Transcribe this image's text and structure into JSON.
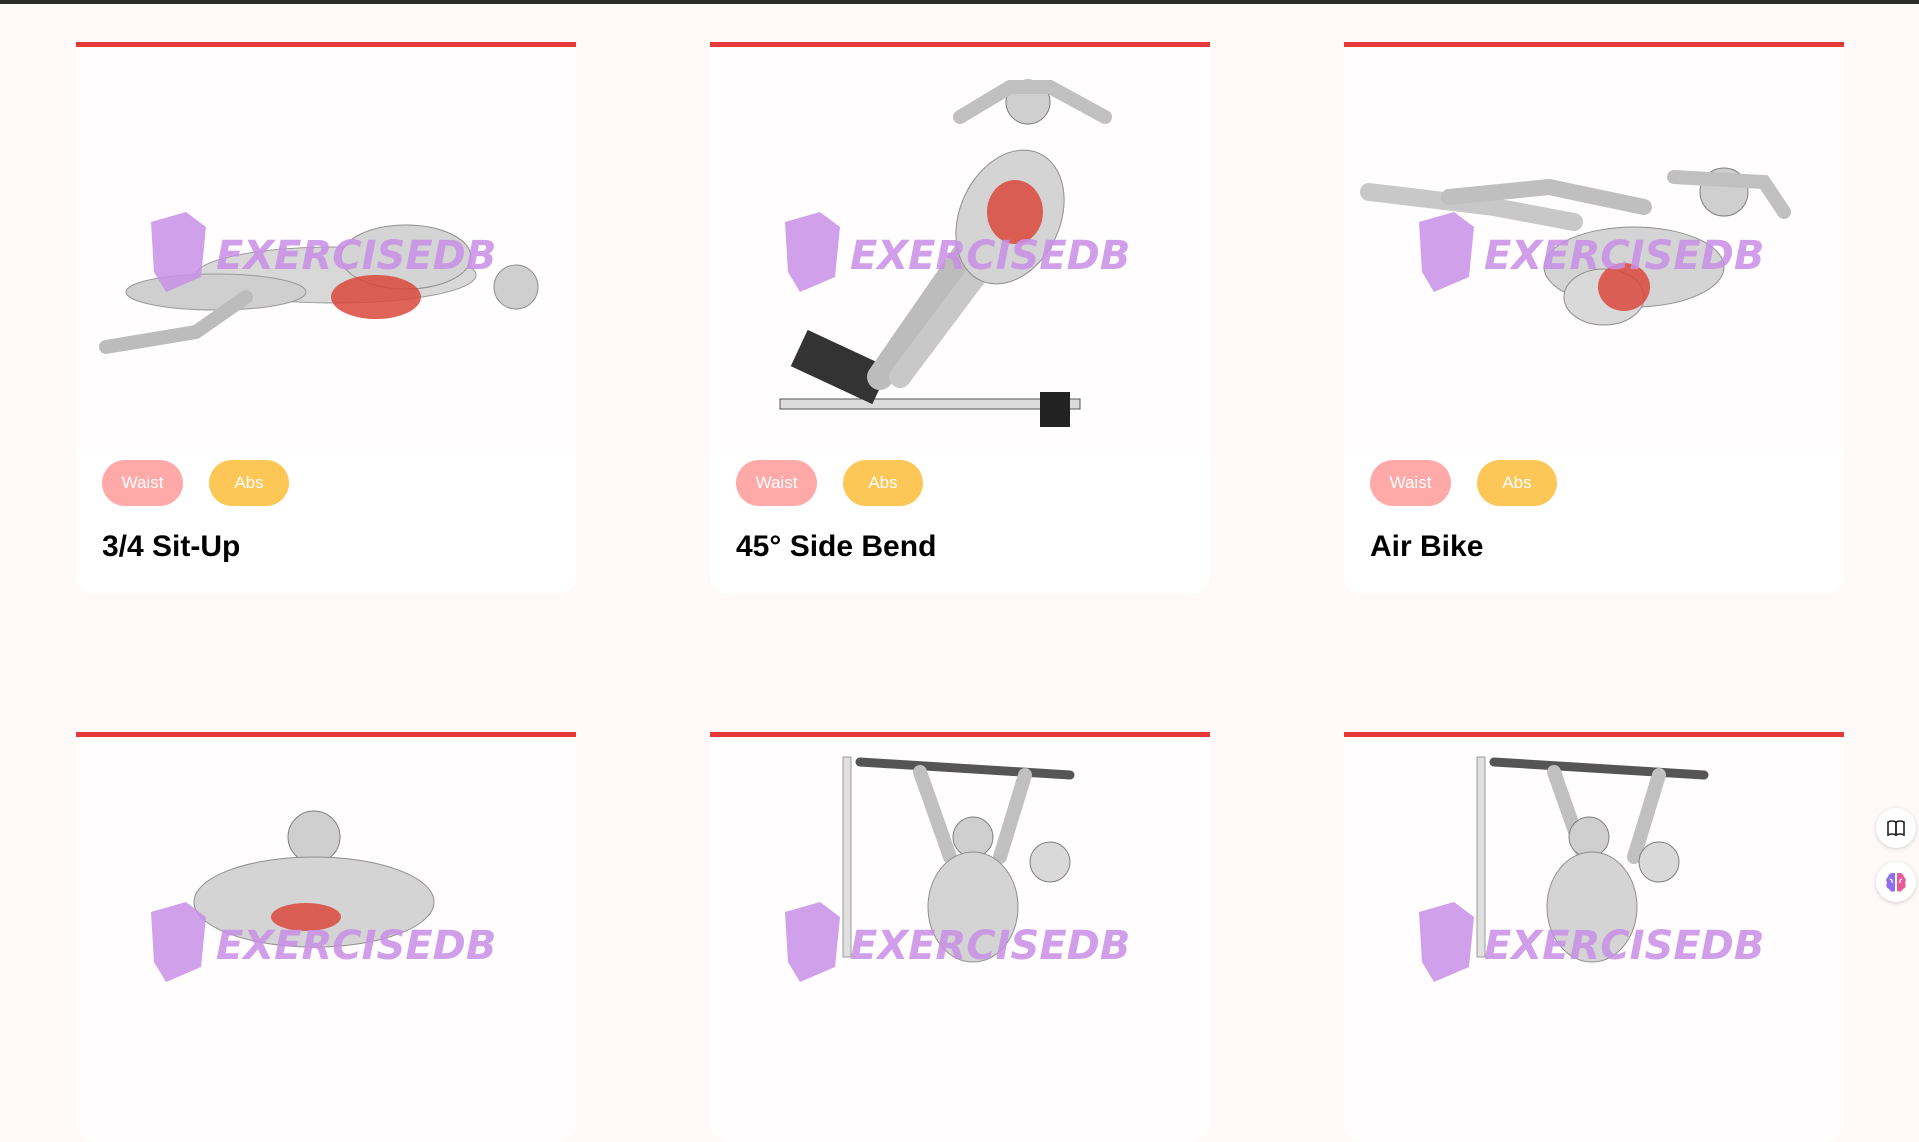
{
  "watermark": "EXERCISEDB",
  "colors": {
    "accent_bar": "#e63a3a",
    "body_part_tag": "#ffa9a9",
    "target_tag": "#fcc757",
    "muscle_highlight": "#d9483b"
  },
  "cards": [
    {
      "body_part": "Waist",
      "target": "Abs",
      "name": "3/4 Sit-Up",
      "illustration": "sit-up-figure"
    },
    {
      "body_part": "Waist",
      "target": "Abs",
      "name": "45° Side Bend",
      "illustration": "side-bend-bench-figure"
    },
    {
      "body_part": "Waist",
      "target": "Abs",
      "name": "Air Bike",
      "illustration": "air-bike-figure"
    },
    {
      "body_part": "",
      "target": "",
      "name": "",
      "illustration": "crunch-figure"
    },
    {
      "body_part": "",
      "target": "",
      "name": "",
      "illustration": "hanging-leg-raise-figure"
    },
    {
      "body_part": "",
      "target": "",
      "name": "",
      "illustration": "hanging-leg-raise-figure"
    }
  ],
  "side_buttons": [
    {
      "icon": "book-icon"
    },
    {
      "icon": "brain-icon"
    }
  ]
}
